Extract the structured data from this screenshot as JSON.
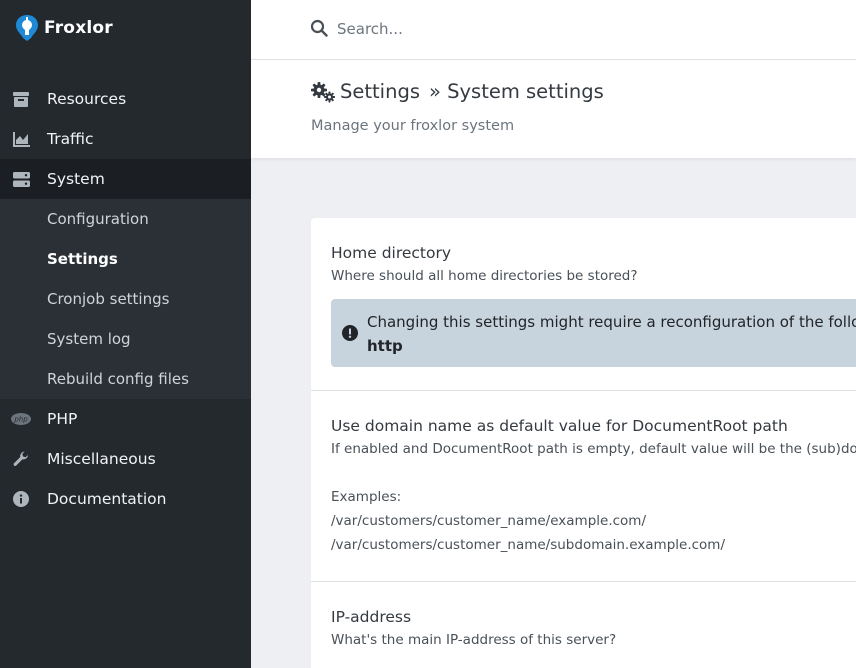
{
  "brand": {
    "name": "Froxlor",
    "accent": "#1e8ad6"
  },
  "search": {
    "placeholder": "Search..."
  },
  "sidebar": {
    "items": [
      {
        "label": "Resources",
        "icon": "box-icon"
      },
      {
        "label": "Traffic",
        "icon": "chart-area-icon"
      },
      {
        "label": "System",
        "icon": "server-icon"
      },
      {
        "label": "PHP",
        "icon": "php-icon"
      },
      {
        "label": "Miscellaneous",
        "icon": "wrench-icon"
      },
      {
        "label": "Documentation",
        "icon": "info-circle-icon"
      }
    ],
    "system_sub": [
      {
        "label": "Configuration"
      },
      {
        "label": "Settings"
      },
      {
        "label": "Cronjob settings"
      },
      {
        "label": "System log"
      },
      {
        "label": "Rebuild config files"
      }
    ]
  },
  "header": {
    "title": "Settings",
    "breadcrumb": "» System settings",
    "subtitle": "Manage your froxlor system"
  },
  "settings": {
    "home_directory": {
      "title": "Home directory",
      "description": "Where should all home directories be stored?",
      "alert_text": "Changing this settings might require a reconfiguration of the following services:",
      "alert_service": "http"
    },
    "docroot_default": {
      "title": "Use domain name as default value for DocumentRoot path",
      "description": "If enabled and DocumentRoot path is empty, default value will be the (sub)domain name.",
      "examples_label": "Examples:",
      "example_1": "/var/customers/customer_name/example.com/",
      "example_2": "/var/customers/customer_name/subdomain.example.com/"
    },
    "ip_address": {
      "title": "IP-address",
      "description": "What's the main IP-address of this server?"
    }
  }
}
